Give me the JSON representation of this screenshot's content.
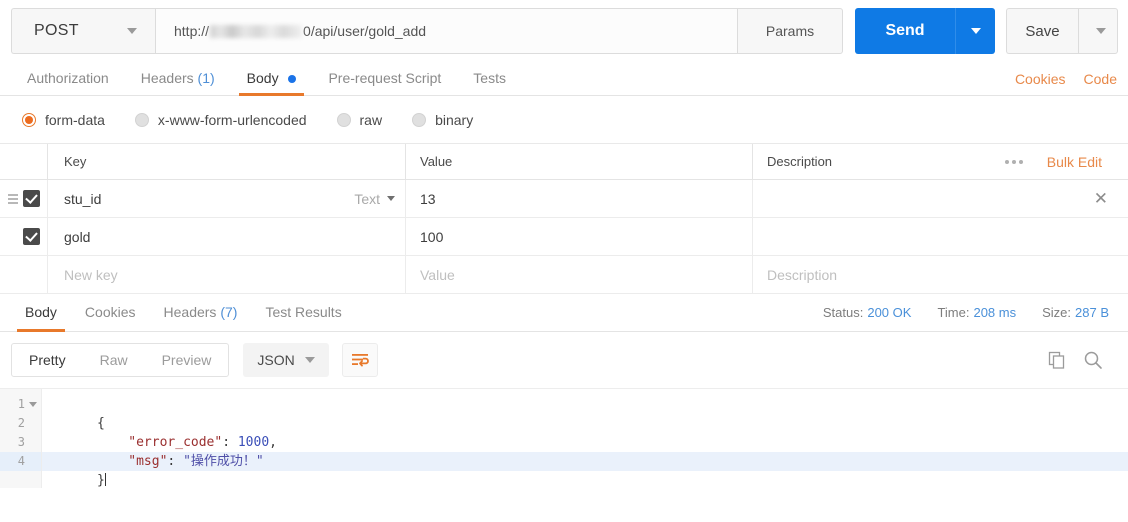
{
  "request": {
    "method": "POST",
    "url_prefix": "http://",
    "url_suffix": "0/api/user/gold_add",
    "url_full": "http://[redacted]0/api/user/gold_add",
    "params_label": "Params",
    "send_label": "Send",
    "save_label": "Save"
  },
  "request_tabs": {
    "items": [
      {
        "label": "Authorization",
        "count": "",
        "active": false
      },
      {
        "label": "Headers",
        "count": "(1)",
        "active": false
      },
      {
        "label": "Body",
        "count": "",
        "active": true,
        "dot": true
      },
      {
        "label": "Pre-request Script",
        "count": "",
        "active": false
      },
      {
        "label": "Tests",
        "count": "",
        "active": false
      }
    ],
    "links": [
      {
        "label": "Cookies"
      },
      {
        "label": "Code"
      }
    ]
  },
  "body_types": [
    {
      "label": "form-data",
      "selected": true
    },
    {
      "label": "x-www-form-urlencoded",
      "selected": false
    },
    {
      "label": "raw",
      "selected": false
    },
    {
      "label": "binary",
      "selected": false
    }
  ],
  "kv_table": {
    "headers": {
      "key": "Key",
      "value": "Value",
      "description": "Description"
    },
    "bulk_edit_label": "Bulk Edit",
    "rows": [
      {
        "checked": true,
        "key": "stu_id",
        "type": "Text",
        "value": "13",
        "description": ""
      },
      {
        "checked": true,
        "key": "gold",
        "type": "",
        "value": "100",
        "description": ""
      }
    ],
    "new_row": {
      "key_placeholder": "New key",
      "value_placeholder": "Value",
      "description_placeholder": "Description"
    }
  },
  "response_tabs": {
    "items": [
      {
        "label": "Body",
        "count": "",
        "active": true
      },
      {
        "label": "Cookies",
        "count": "",
        "active": false
      },
      {
        "label": "Headers",
        "count": "(7)",
        "active": false
      },
      {
        "label": "Test Results",
        "count": "",
        "active": false
      }
    ],
    "meta": {
      "status_label": "Status:",
      "status_value": "200 OK",
      "time_label": "Time:",
      "time_value": "208 ms",
      "size_label": "Size:",
      "size_value": "287 B"
    }
  },
  "response_toolbar": {
    "views": [
      {
        "label": "Pretty",
        "active": true
      },
      {
        "label": "Raw",
        "active": false
      },
      {
        "label": "Preview",
        "active": false
      }
    ],
    "format": "JSON"
  },
  "response_body": {
    "lines": [
      {
        "number": "1",
        "foldable": true,
        "highlighted": false
      },
      {
        "number": "2",
        "foldable": false,
        "highlighted": false
      },
      {
        "number": "3",
        "foldable": false,
        "highlighted": false
      },
      {
        "number": "4",
        "foldable": false,
        "highlighted": true
      }
    ],
    "json": {
      "error_code_key": "\"error_code\"",
      "error_code_value": "1000",
      "msg_key": "\"msg\"",
      "msg_value": "\"操作成功！\"",
      "open_brace": "{",
      "close_brace": "}"
    }
  },
  "colors": {
    "accent_orange": "#e8792b",
    "send_blue": "#0f7ae5",
    "meta_blue": "#4a90d9",
    "link_orange": "#e8894a"
  }
}
